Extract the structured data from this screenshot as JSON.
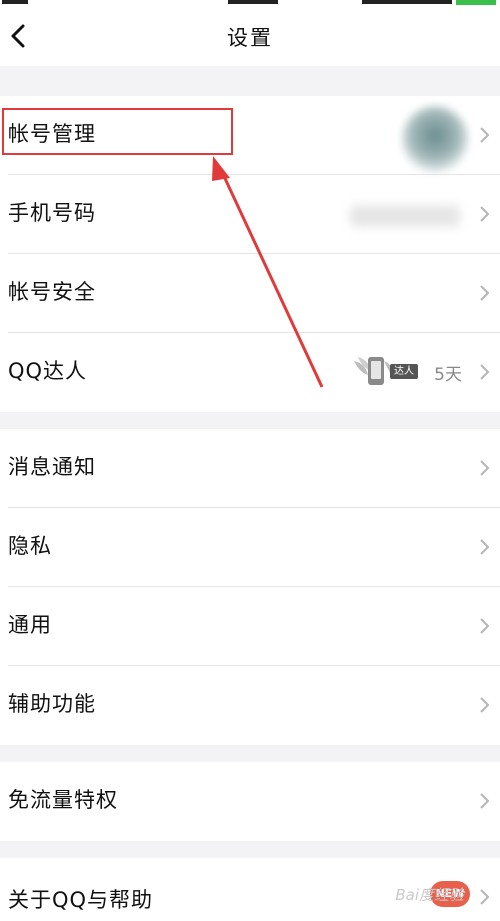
{
  "header": {
    "title": "设置",
    "back_icon": "chevron-left-icon"
  },
  "groups": [
    {
      "items": [
        {
          "label": "帐号管理",
          "icon": "chevron-right-icon"
        },
        {
          "label": "手机号码",
          "icon": "chevron-right-icon"
        },
        {
          "label": "帐号安全",
          "icon": "chevron-right-icon"
        },
        {
          "label": "QQ达人",
          "badge_text": "达人",
          "days": "5天",
          "icon": "chevron-right-icon"
        }
      ]
    },
    {
      "items": [
        {
          "label": "消息通知",
          "icon": "chevron-right-icon"
        },
        {
          "label": "隐私",
          "icon": "chevron-right-icon"
        },
        {
          "label": "通用",
          "icon": "chevron-right-icon"
        },
        {
          "label": "辅助功能",
          "icon": "chevron-right-icon"
        }
      ]
    },
    {
      "items": [
        {
          "label": "免流量特权",
          "icon": "chevron-right-icon"
        }
      ]
    },
    {
      "items": [
        {
          "label": "关于QQ与帮助",
          "badge_text": "NEW",
          "icon": "chevron-right-icon"
        }
      ]
    }
  ],
  "annotation": {
    "highlight_color": "#e03a3a"
  },
  "watermark": {
    "text": "Bai度经验"
  }
}
